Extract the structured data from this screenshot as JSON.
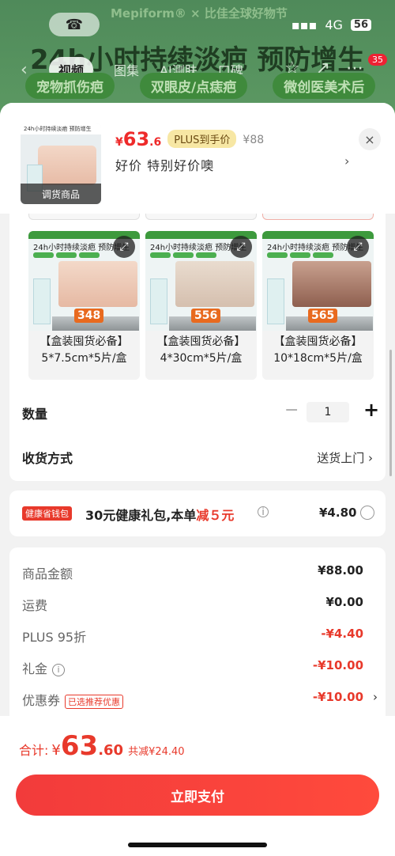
{
  "background": {
    "banner": "Mepiform® × 比佳全球好物节",
    "title": "24h小时持续淡疤 预防增生",
    "tabs": [
      "视频",
      "图集",
      "AI测肤",
      "口碑"
    ],
    "pills": [
      "宠物抓伤疤",
      "双眼皮/点痣疤",
      "微创医美术后"
    ],
    "badge": "35",
    "status": {
      "network": "4G",
      "battery": "56"
    }
  },
  "header": {
    "thumb_label": "调货商品",
    "thumb_title": "24h小时持续淡疤 预防增生",
    "price_yen": "¥",
    "price_int": "63",
    "price_dec": ".6",
    "plus_tag": "PLUS到手价",
    "original_price": "¥88",
    "subtitle": "好价  特别好价噢",
    "close_icon": "×",
    "chevron": "›"
  },
  "variants": [
    {
      "title": "24h小时持续淡疤 预防增生",
      "price": "348",
      "line1": "【盒装囤货必备】",
      "line2": "5*7.5cm*5片/盒"
    },
    {
      "title": "24h小时持续淡疤 预防增生",
      "price": "556",
      "line1": "【盒装囤货必备】",
      "line2": "4*30cm*5片/盒"
    },
    {
      "title": "24h小时持续淡疤 预防增生",
      "price": "565",
      "line1": "【盒装囤货必备】",
      "line2": "10*18cm*5片/盒"
    }
  ],
  "quantity": {
    "label": "数量",
    "minus": "−",
    "value": "1",
    "plus": "+"
  },
  "shipping": {
    "label": "收货方式",
    "value": "送货上门 ›"
  },
  "wallet": {
    "tag": "健康省钱包",
    "text_prefix": "30元健康礼包,本单",
    "text_red": "减５元",
    "info": "i",
    "price": "¥4.80"
  },
  "summary": {
    "rows": [
      {
        "label": "商品金额",
        "value": "¥88.00",
        "red": false
      },
      {
        "label": "运费",
        "value": "¥0.00",
        "red": false
      },
      {
        "label": "PLUS 95折",
        "value": "-¥4.40",
        "red": true
      },
      {
        "label": "礼金",
        "value": "-¥10.00",
        "red": true
      },
      {
        "label": "优惠券",
        "value": "-¥10.00",
        "red": true
      }
    ],
    "coupon_badge": "已选推荐优惠"
  },
  "footer": {
    "total_label": "合计:",
    "yen": "¥",
    "total_int": "63",
    "total_dec": ".60",
    "saved": "共减¥24.40",
    "pay_button": "立即支付"
  },
  "colors": {
    "accent": "#e8392b",
    "plus_tag_bg": "#f7e7a4"
  }
}
